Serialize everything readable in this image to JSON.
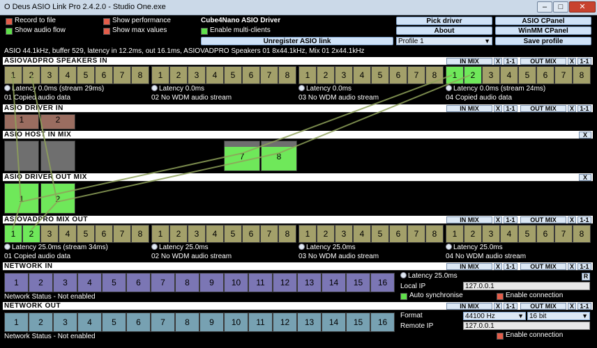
{
  "window": {
    "title": "O Deus ASIO Link Pro 2.4.2.0 - Studio One.exe",
    "min": "–",
    "max": "□",
    "close": "✕"
  },
  "options": {
    "record_to_file": "Record to file",
    "show_audio_flow": "Show audio flow",
    "show_performance": "Show performance",
    "show_max_values": "Show max values",
    "driver_name": "Cube4Nano ASIO Driver",
    "enable_multi_clients": "Enable multi-clients",
    "unregister": "Unregister ASIO link",
    "profile": "Profile 1"
  },
  "buttons": {
    "pick_driver": "Pick driver",
    "about": "About",
    "asio_cpanel": "ASIO CPanel",
    "winmm_cpanel": "WinMM CPanel",
    "save_profile": "Save profile"
  },
  "status_line": "ASIO 44.1kHz, buffer 529, latency in 12.2ms, out 16.1ms, ASIOVADPRO Speakers 01 8x44.1kHz, Mix 01 2x44.1kHz",
  "small": {
    "in_mix": "IN MIX",
    "out_mix": "OUT MIX",
    "x": "X",
    "one_one": "1-1",
    "r": "R"
  },
  "sections": {
    "speakers_in": "ASIOVADPRO SPEAKERS IN",
    "driver_in": "ASIO DRIVER IN",
    "host_in_mix": "ASIO HOST IN MIX",
    "driver_out_mix": "ASIO DRIVER OUT MIX",
    "mix_out": "ASIOVADPRO MIX OUT",
    "network_in": "NETWORK IN",
    "network_out": "NETWORK OUT"
  },
  "speakers_in": {
    "groups": [
      {
        "latency": "Latency 0.0ms (stream 29ms)",
        "label": "01 Copied audio data"
      },
      {
        "latency": "Latency 0.0ms",
        "label": "02 No WDM audio stream"
      },
      {
        "latency": "Latency 0.0ms",
        "label": "03 No WDM audio stream"
      },
      {
        "latency": "Latency 0.0ms (stream 24ms)",
        "label": "04 Copied audio data"
      }
    ]
  },
  "mix_out": {
    "groups": [
      {
        "latency": "Latency 25.0ms (stream 34ms)",
        "label": "01 Copied audio data"
      },
      {
        "latency": "Latency 25.0ms",
        "label": "02 No WDM audio stream"
      },
      {
        "latency": "Latency 25.0ms",
        "label": "03 No WDM audio stream"
      },
      {
        "latency": "Latency 25.0ms",
        "label": "04 No WDM audio stream"
      }
    ]
  },
  "channel_numbers": [
    "1",
    "2",
    "3",
    "4",
    "5",
    "6",
    "7",
    "8"
  ],
  "network_numbers": [
    "1",
    "2",
    "3",
    "4",
    "5",
    "6",
    "7",
    "8",
    "9",
    "10",
    "11",
    "12",
    "13",
    "14",
    "15",
    "16"
  ],
  "driver_in_channels": [
    "1",
    "2"
  ],
  "host_in_mix_channels": [
    "7",
    "8"
  ],
  "driver_out_mix_channels": [
    "1",
    "2"
  ],
  "network_in": {
    "status": "Network Status - Not enabled",
    "latency": "Latency 25.0ms",
    "local_ip_label": "Local IP",
    "local_ip": "127.0.0.1",
    "auto_sync": "Auto synchronise",
    "enable_connection": "Enable connection"
  },
  "network_out": {
    "status": "Network Status - Not enabled",
    "format_label": "Format",
    "format_rate": "44100 Hz",
    "format_bits": "16 bit",
    "remote_ip_label": "Remote IP",
    "remote_ip": "127.0.0.1",
    "enable_connection": "Enable connection"
  },
  "colors": {
    "olive": "#a3a06a",
    "active_green": "#6fe85a",
    "network_in": "#7b76b4",
    "network_out": "#77a1b2",
    "driver_in": "#9a6d60",
    "section_header": "#ffffff"
  }
}
